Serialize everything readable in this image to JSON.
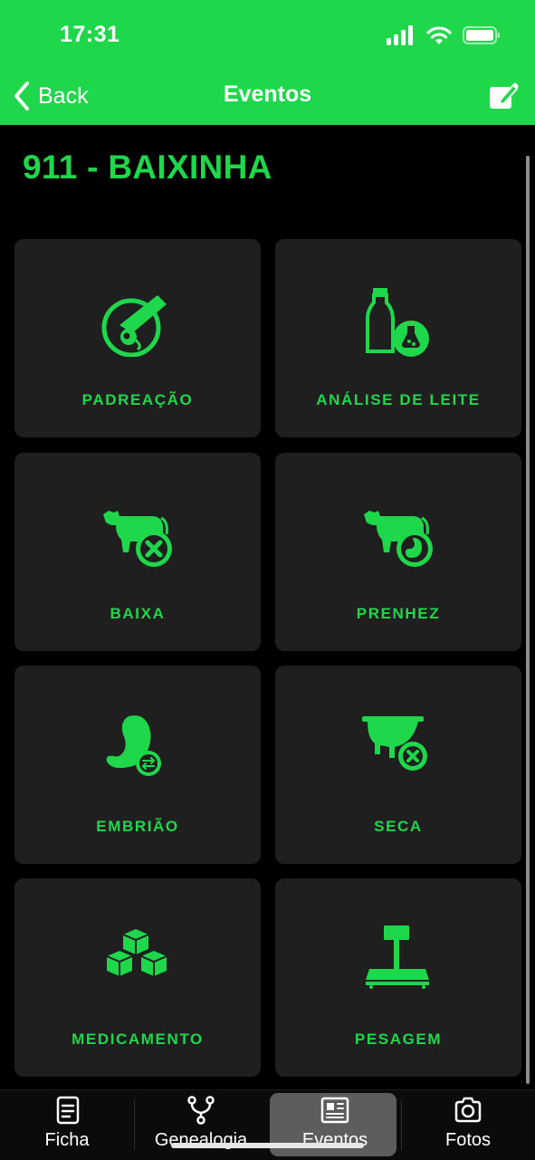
{
  "status_bar": {
    "time": "17:31",
    "icons": [
      "signal-bars-icon",
      "wifi-icon",
      "battery-icon"
    ]
  },
  "nav": {
    "back_label": "Back",
    "title": "Eventos",
    "edit_icon": "edit-note-icon"
  },
  "animal": {
    "title": "911 - BAIXINHA"
  },
  "tiles": [
    {
      "label": "PADREAÇÃO",
      "icon": "insemination-icon"
    },
    {
      "label": "ANÁLISE DE LEITE",
      "icon": "milk-analysis-icon"
    },
    {
      "label": "BAIXA",
      "icon": "cow-remove-icon"
    },
    {
      "label": "PRENHEZ",
      "icon": "cow-pregnancy-icon"
    },
    {
      "label": "EMBRIÃO",
      "icon": "embryo-transfer-icon"
    },
    {
      "label": "SECA",
      "icon": "udder-dry-icon"
    },
    {
      "label": "MEDICAMENTO",
      "icon": "medicine-boxes-icon"
    },
    {
      "label": "PESAGEM",
      "icon": "scale-icon"
    }
  ],
  "tab_bar": {
    "tabs": [
      {
        "label": "Ficha",
        "icon": "document-icon",
        "active": false
      },
      {
        "label": "Genealogia",
        "icon": "branch-icon",
        "active": false
      },
      {
        "label": "Eventos",
        "icon": "newspaper-icon",
        "active": true
      },
      {
        "label": "Fotos",
        "icon": "camera-icon",
        "active": false
      }
    ]
  },
  "colors": {
    "accent": "#1ed74b",
    "tile_bg": "#1f1f1f",
    "background": "#000000",
    "active_tab_bg": "#5d5d5d"
  }
}
